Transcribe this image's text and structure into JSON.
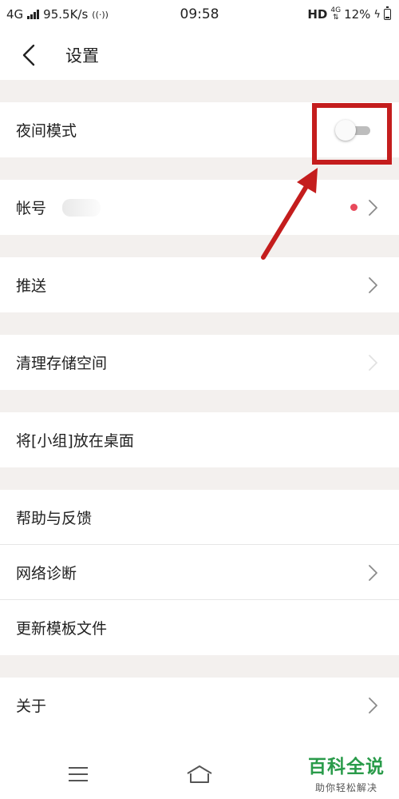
{
  "status_bar": {
    "network": "4G",
    "speed": "95.5K/s",
    "time": "09:58",
    "hd": "HD",
    "net_small": "4G",
    "battery": "12%"
  },
  "header": {
    "title": "设置"
  },
  "settings": {
    "night_mode": {
      "label": "夜间模式",
      "toggle_on": false
    },
    "account": {
      "label": "帐号"
    },
    "push": {
      "label": "推送"
    },
    "clear_storage": {
      "label": "清理存储空间"
    },
    "add_group_desktop": {
      "label": "将[小组]放在桌面"
    },
    "help_feedback": {
      "label": "帮助与反馈"
    },
    "network_diagnosis": {
      "label": "网络诊断"
    },
    "update_template": {
      "label": "更新模板文件"
    },
    "about": {
      "label": "关于"
    }
  },
  "watermark": {
    "main": "百科全说",
    "sub": "助你轻松解决"
  },
  "colors": {
    "accent_red": "#c41d1d",
    "badge_red": "#e8495b",
    "watermark_green": "#2a9b4a",
    "section_gap": "#f3f0ee"
  }
}
